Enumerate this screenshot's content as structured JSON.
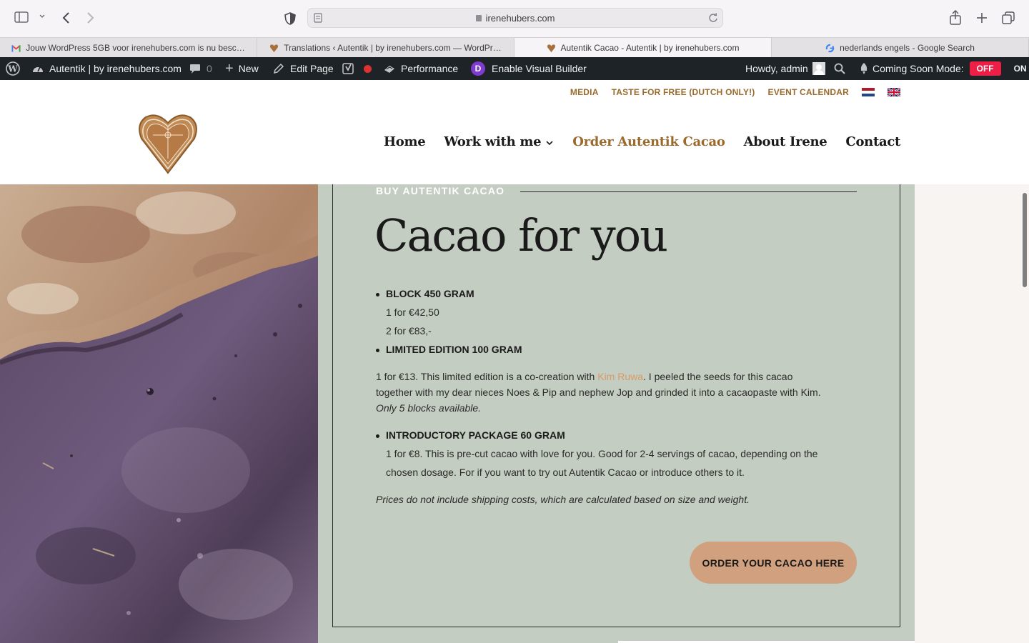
{
  "browser": {
    "url": "irenehubers.com",
    "tabs": [
      {
        "title": "Jouw WordPress 5GB voor irenehubers.com is nu besc…",
        "icon": "gmail-icon"
      },
      {
        "title": "Translations ‹ Autentik | by irenehubers.com — WordPr…",
        "icon": "heart-favicon"
      },
      {
        "title": "Autentik Cacao - Autentik | by irenehubers.com",
        "icon": "heart-favicon",
        "active": true
      },
      {
        "title": "nederlands engels - Google Search",
        "icon": "google-icon"
      }
    ]
  },
  "adminbar": {
    "site": "Autentik | by irenehubers.com",
    "comments": "0",
    "new": "New",
    "edit": "Edit Page",
    "performance": "Performance",
    "visual_builder": "Enable Visual Builder",
    "howdy": "Howdy, admin",
    "coming_soon": "Coming Soon Mode:",
    "off": "OFF",
    "on": "ON"
  },
  "topnav": [
    "MEDIA",
    "TASTE FOR FREE (DUTCH ONLY!)",
    "EVENT CALENDAR"
  ],
  "mainnav": [
    "Home",
    "Work with me",
    "Order Autentik Cacao",
    "About Irene",
    "Contact"
  ],
  "content": {
    "eyebrow": "BUY AUTENTIK CACAO",
    "title": "Cacao for you",
    "item1": "BLOCK 450 GRAM",
    "item1_a": "1 for €42,50",
    "item1_b": "2 for €83,-",
    "item2": "LIMITED EDITION 100 GRAM",
    "para_a": "1 for €13. This limited edition is a co-creation with ",
    "para_link": "Kim Ruwa",
    "para_b": ". I peeled the seeds for this cacao",
    "para_c": "together with my dear nieces Noes & Pip and nephew Jop and grinded it into a cacaopaste with Kim.",
    "para_d": "Only 5 blocks available.",
    "item3": "INTRODUCTORY PACKAGE 60 GRAM",
    "item3_a": "1 for €8. This is pre-cut cacao with love for you. Good for 2-4 servings of cacao, depending on the",
    "item3_b": "chosen dosage. For if you want to try out Autentik Cacao or introduce others to it.",
    "note": "Prices do not include shipping costs, which are calculated based on size and weight.",
    "button": "ORDER YOUR CACAO HERE"
  },
  "colors": {
    "accent": "#9a6b2d",
    "panel": "#c4cdc1",
    "button": "#d1a07f",
    "link": "#d99a66"
  }
}
